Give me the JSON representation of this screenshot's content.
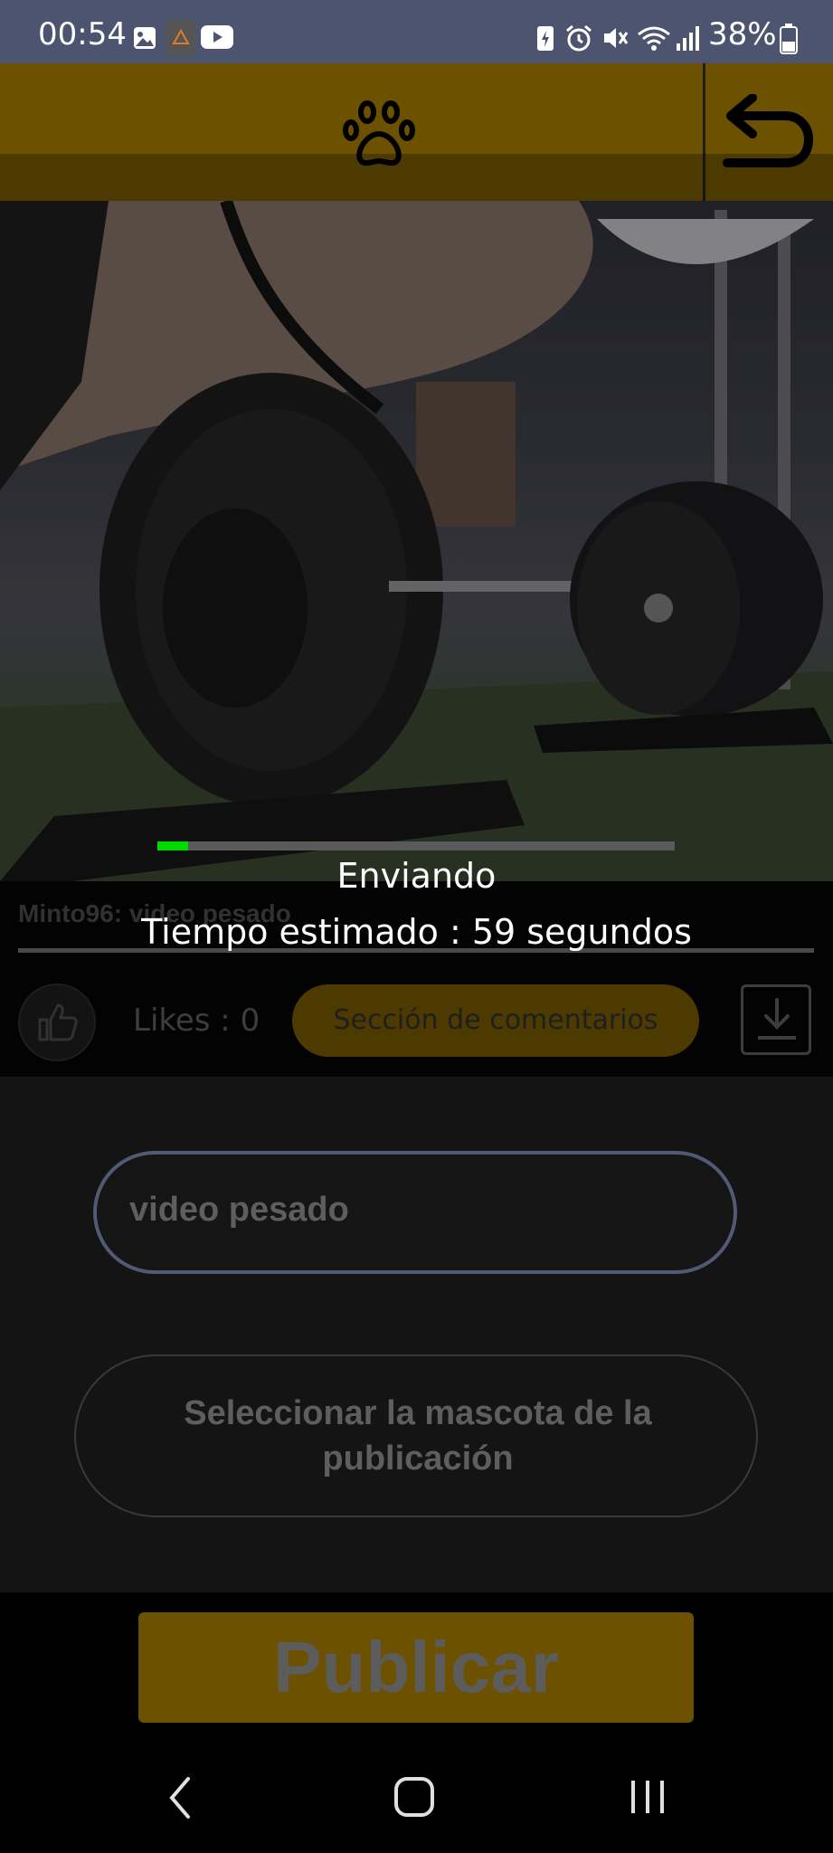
{
  "status_bar": {
    "time": "00:54",
    "battery": "38%"
  },
  "post": {
    "author_title": "Minto96: video pesado",
    "likes_label": "Likes : 0",
    "comments_button": "Sección de comentarios"
  },
  "upload": {
    "status": "Enviando",
    "estimate": "Tiempo estimado : 59 segundos",
    "progress_fraction": 0.06
  },
  "form": {
    "description_value": "video pesado",
    "pet_select_label": "Seleccionar la mascota de la publicación",
    "publish_label": "Publicar"
  },
  "colors": {
    "status_bar": "#4c5470",
    "accent_gold": "#6b5100",
    "progress_green": "#00d800"
  }
}
